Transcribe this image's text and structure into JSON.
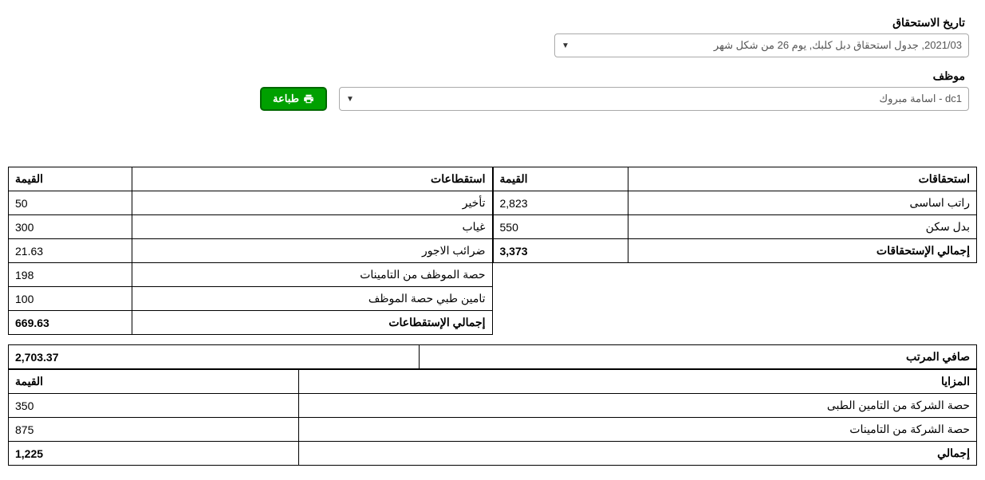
{
  "form": {
    "date_label": "تاريخ الاستحقاق",
    "date_value": "2021/03, جدول استحقاق دبل كلبك, يوم 26 من شكل شهر",
    "employee_label": "موظف",
    "employee_value": "dc1 - اسامة مبروك",
    "print_label": "طباعة"
  },
  "entitlements": {
    "header_label": "استحقاقات",
    "header_value": "القيمة",
    "rows": [
      {
        "label": "راتب اساسى",
        "value": "2,823"
      },
      {
        "label": "بدل سكن",
        "value": "550"
      }
    ],
    "total_label": "إجمالي الإستحقاقات",
    "total_value": "3,373"
  },
  "deductions": {
    "header_label": "استقطاعات",
    "header_value": "القيمة",
    "rows": [
      {
        "label": "تأخير",
        "value": "50"
      },
      {
        "label": "غياب",
        "value": "300"
      },
      {
        "label": "ضرائب الاجور",
        "value": "21.63"
      },
      {
        "label": "حصة الموظف من التامينات",
        "value": "198"
      },
      {
        "label": "تامين طبي حصة الموظف",
        "value": "100"
      }
    ],
    "total_label": "إجمالي الإستقطاعات",
    "total_value": "669.63"
  },
  "net": {
    "label": "صافي المرتب",
    "value": "2,703.37"
  },
  "benefits": {
    "header_label": "المزايا",
    "header_value": "القيمة",
    "rows": [
      {
        "label": "حصة الشركة من التامين الطبى",
        "value": "350"
      },
      {
        "label": "حصة الشركة من التامينات",
        "value": "875"
      }
    ],
    "total_label": "إجمالي",
    "total_value": "1,225"
  }
}
